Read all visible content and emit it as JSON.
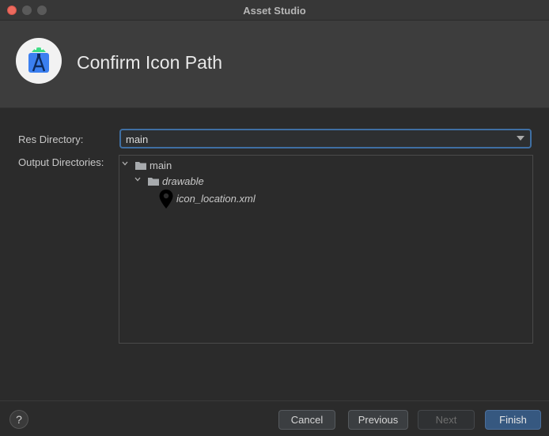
{
  "window": {
    "title": "Asset Studio"
  },
  "header": {
    "title": "Confirm Icon Path",
    "icon": "android-studio-icon"
  },
  "form": {
    "res_directory_label": "Res Directory:",
    "res_directory_value": "main",
    "output_directories_label": "Output Directories:"
  },
  "tree": {
    "root": "main",
    "folder": "drawable",
    "file": "icon_location.xml"
  },
  "footer": {
    "help_label": "?",
    "cancel_label": "Cancel",
    "previous_label": "Previous",
    "next_label": "Next",
    "finish_label": "Finish"
  },
  "colors": {
    "accent": "#365880",
    "focus_border": "#3f6fa3",
    "close": "#ed6a5e"
  }
}
